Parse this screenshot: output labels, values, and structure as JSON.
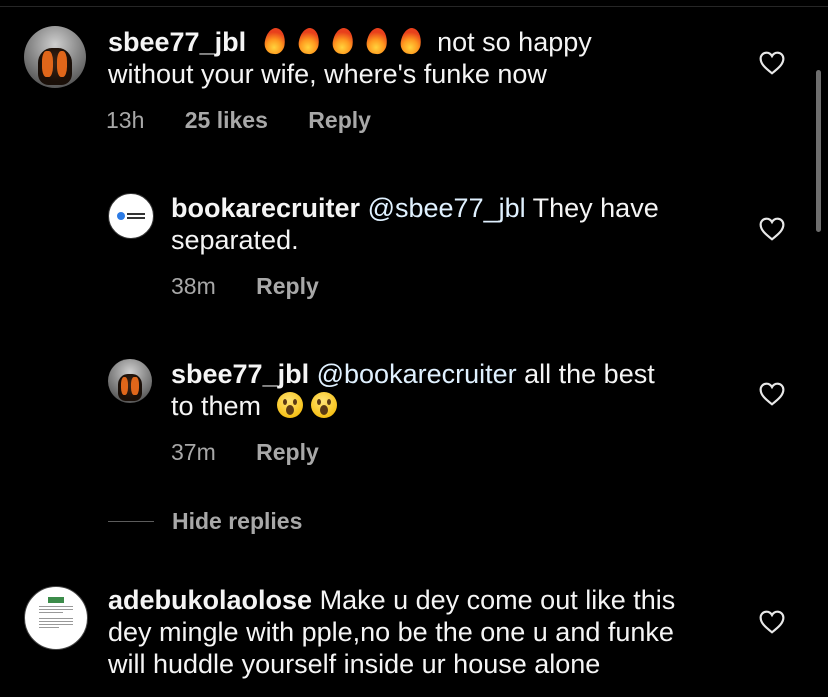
{
  "comments": [
    {
      "username": "sbee77_jbl",
      "text_line1": "not so happy",
      "text_line2": "without your wife, where's funke now",
      "emoji_count": 5,
      "emoji": "fire",
      "time": "13h",
      "likes": "25 likes",
      "reply_label": "Reply",
      "avatar": "profile-photo"
    },
    {
      "username": "bookarecruiter",
      "mention": "@sbee77_jbl",
      "text_line1": "They have",
      "text_line2": "separated.",
      "time": "38m",
      "reply_label": "Reply",
      "avatar": "company-logo"
    },
    {
      "username": "sbee77_jbl",
      "mention": "@bookarecruiter",
      "text_line1": "all the best",
      "text_line2": "to them",
      "emoji_count": 2,
      "emoji": "astonished-face",
      "time": "37m",
      "reply_label": "Reply",
      "avatar": "profile-photo"
    },
    {
      "username": "adebukolaolose",
      "text_line1": "Make u dey come out like this",
      "text_line2": "dey mingle with pple,no be the one u and funke",
      "text_line3": "will huddle yourself inside ur house alone",
      "avatar": "document-image"
    }
  ],
  "hide_replies_label": "Hide replies",
  "icons": {
    "like": "heart-outline-icon"
  },
  "colors": {
    "background": "#000000",
    "text": "#f5f5f5",
    "meta": "#a8a8a8",
    "mention": "#e0f1ff"
  }
}
